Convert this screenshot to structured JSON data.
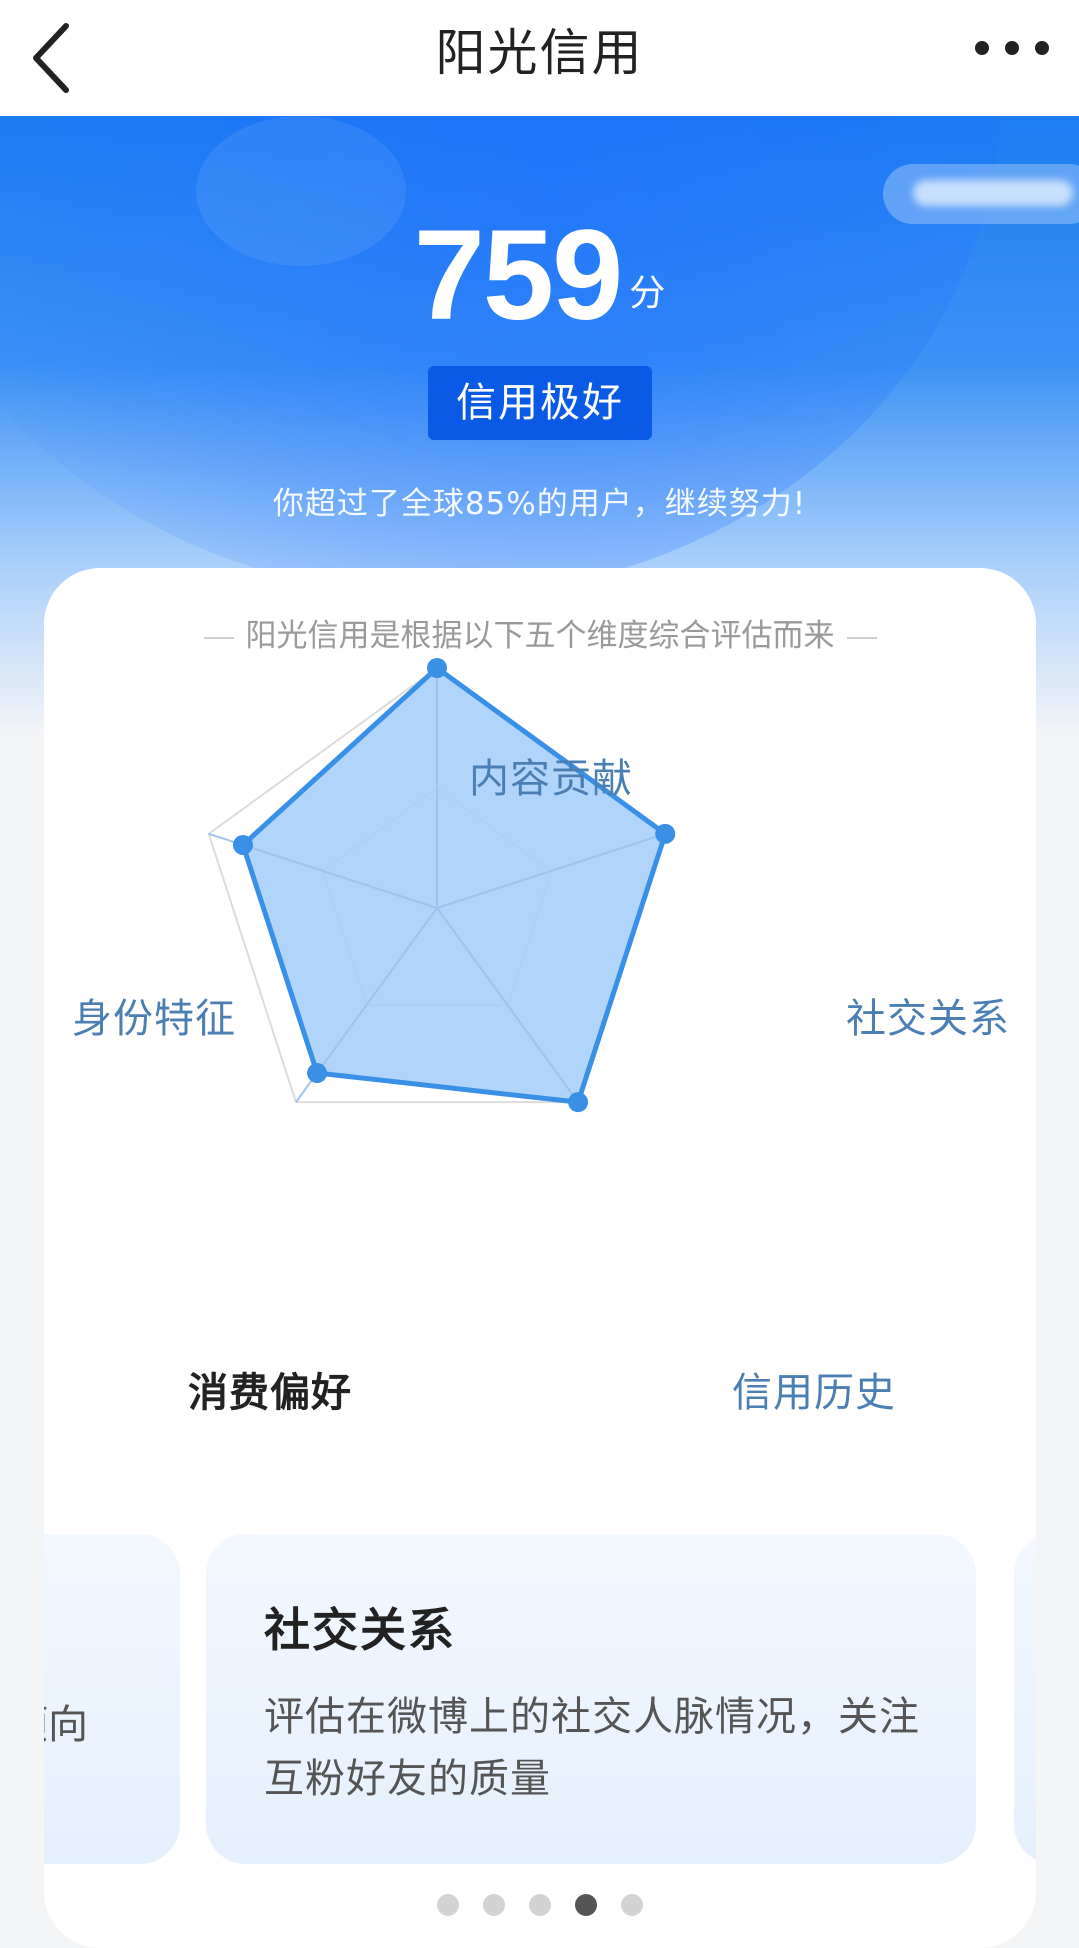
{
  "navbar": {
    "title": "阳光信用",
    "back_icon": "chevron-left-icon",
    "more_icon": "more-horizontal-icon"
  },
  "hero": {
    "score": "759",
    "unit": "分",
    "level": "信用极好",
    "subtitle": "你超过了全球85%的用户，继续努力!"
  },
  "card": {
    "caption": "阳光信用是根据以下五个维度综合评估而来",
    "radar": {
      "dimensions": [
        {
          "label": "内容贡献",
          "score": 1.0
        },
        {
          "label": "社交关系",
          "score": 1.0
        },
        {
          "label": "信用历史",
          "score": 1.0
        },
        {
          "label": "消费偏好",
          "score": 0.85,
          "active": true
        },
        {
          "label": "身份特征",
          "score": 0.85
        }
      ]
    },
    "carousel": {
      "prev_slide_fragment": "倾向",
      "slide": {
        "title": "社交关系",
        "description": "评估在微博上的社交人脉情况，关注互粉好友的质量"
      },
      "page_count": 5,
      "current_page": 4
    }
  },
  "colors": {
    "brand_blue": "#1c7cf2",
    "badge_blue": "#0a5ae6",
    "radar_stroke": "#3a8fe6",
    "radar_fill": "#a8d0fa",
    "label_blue": "#4b7fb3"
  }
}
